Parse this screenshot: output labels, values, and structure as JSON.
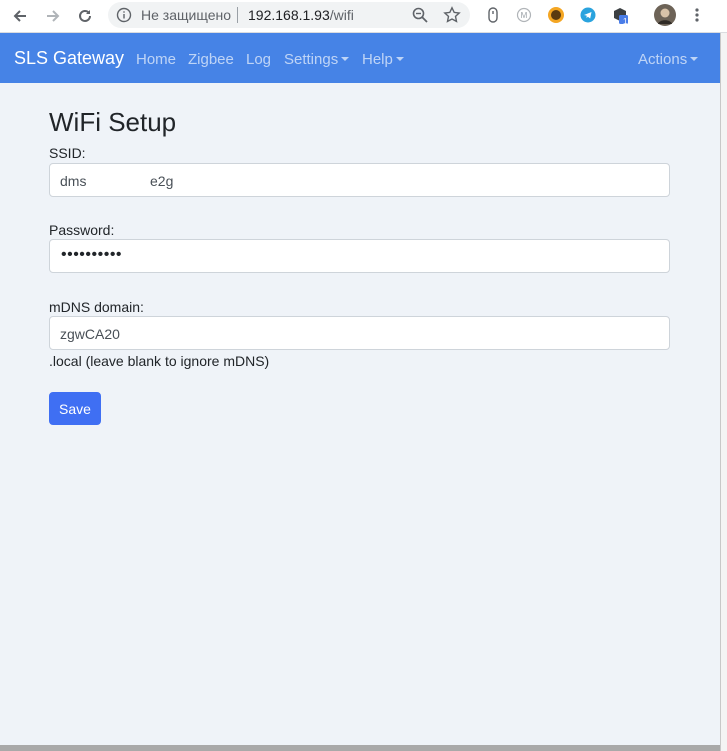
{
  "browser": {
    "security_text": "Не защищено",
    "url_host": "192.168.1.93",
    "url_path": "/wifi",
    "extension_badge": "1"
  },
  "navbar": {
    "brand": "SLS Gateway",
    "links": [
      "Home",
      "Zigbee",
      "Log"
    ],
    "dropdowns": [
      "Settings",
      "Help"
    ],
    "actions": "Actions",
    "color": "#4683e6"
  },
  "page": {
    "title": "WiFi Setup",
    "ssid_label": "SSID:",
    "ssid_value_start": "dms",
    "ssid_value_end": "e2g",
    "password_label": "Password:",
    "password_masked": "••••••••••",
    "mdns_label": "mDNS domain:",
    "mdns_value": "zgwCA20",
    "mdns_help": ".local (leave blank to ignore mDNS)",
    "save_label": "Save",
    "button_color": "#3f6ff3"
  }
}
